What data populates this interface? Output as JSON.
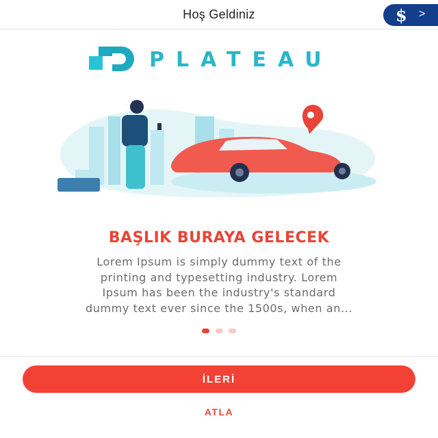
{
  "header": {
    "title": "Hoş Geldiniz",
    "brand_symbol": "$",
    "brand_chevron": ">"
  },
  "logo": {
    "word": "PLATEAU"
  },
  "slide": {
    "title": "BAŞLIK BURAYA GELECEK",
    "body_lines": [
      "Lorem Ipsum is simply dummy text of the",
      "printing and typesetting industry. Lorem",
      "Ipsum has been the industry's standard",
      "dummy text ever since the 1500s, when an..."
    ],
    "page_count": 3,
    "active_page": 1
  },
  "actions": {
    "next_label": "İLERİ",
    "skip_label": "ATLA"
  },
  "colors": {
    "accent": "#e84438",
    "brand_teal": "#29b6c9",
    "brand_navy": "#123e8c"
  }
}
